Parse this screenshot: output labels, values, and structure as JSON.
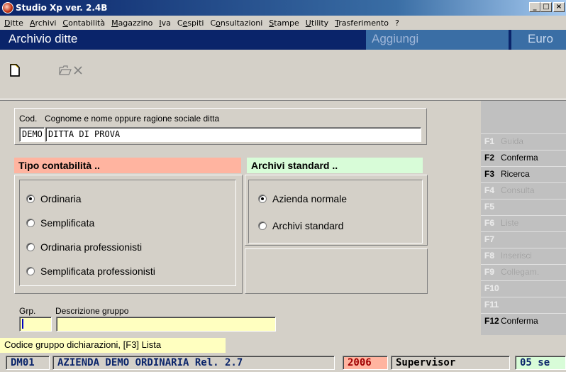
{
  "window": {
    "title": "Studio Xp ver. 2.4B",
    "minimize": "_",
    "maximize": "□",
    "close": "×"
  },
  "menu": [
    {
      "u": "D",
      "rest": "itte"
    },
    {
      "u": "A",
      "rest": "rchivi"
    },
    {
      "u": "C",
      "rest": "ontabilità"
    },
    {
      "u": "M",
      "rest": "agazzino"
    },
    {
      "u": "I",
      "rest": "va"
    },
    {
      "pre": "C",
      "u": "e",
      "rest": "spiti"
    },
    {
      "pre": "C",
      "u": "o",
      "rest": "nsultazioni"
    },
    {
      "u": "S",
      "rest": "tampe"
    },
    {
      "u": "U",
      "rest": "tility"
    },
    {
      "u": "T",
      "rest": "rasferimento"
    },
    {
      "u": "",
      "rest": "?"
    }
  ],
  "header": {
    "title": "Archivio ditte",
    "action": "Aggiungi",
    "currency": "Euro"
  },
  "toolbar": {
    "new": "new-document-icon",
    "open": "open-folder-icon",
    "delete": "delete-x-icon"
  },
  "cod": {
    "label_code": "Cod.",
    "label_name": "Cognome e nome oppure ragione sociale ditta",
    "code_value": "DEMO",
    "name_value": "DITTA DI PROVA"
  },
  "tipo": {
    "heading": "Tipo contabilità ..",
    "heading_color": "#ffb4a0",
    "options": [
      "Ordinaria",
      "Semplificata",
      "Ordinaria professionisti",
      "Semplificata professionisti"
    ],
    "selected": 0
  },
  "archivi": {
    "heading": "Archivi standard ..",
    "heading_color": "#d8fcd8",
    "options": [
      "Azienda normale",
      "Archivi standard"
    ],
    "selected": 0
  },
  "gruppo": {
    "label_code": "Grp.",
    "label_desc": "Descrizione gruppo",
    "code_value": "",
    "desc_value": ""
  },
  "fkeys": [
    {
      "key": "F1",
      "label": "Guida",
      "enabled": false
    },
    {
      "key": "F2",
      "label": "Conferma",
      "enabled": true
    },
    {
      "key": "F3",
      "label": "Ricerca",
      "enabled": true
    },
    {
      "key": "F4",
      "label": "Consulta",
      "enabled": false
    },
    {
      "key": "F5",
      "label": "",
      "enabled": false
    },
    {
      "key": "F6",
      "label": "Liste",
      "enabled": false
    },
    {
      "key": "F7",
      "label": "",
      "enabled": false
    },
    {
      "key": "F8",
      "label": "Inserisci",
      "enabled": false
    },
    {
      "key": "F9",
      "label": "Collegam.",
      "enabled": false
    },
    {
      "key": "F10",
      "label": "",
      "enabled": false
    },
    {
      "key": "F11",
      "label": "",
      "enabled": false
    },
    {
      "key": "F12",
      "label": "Conferma",
      "enabled": true
    }
  ],
  "hint": "Codice gruppo dichiarazioni, [F3] Lista",
  "status": {
    "code": "DM01",
    "company": "AZIENDA DEMO ORDINARIA Rel. 2.7",
    "year": "2006",
    "user": "Supervisor",
    "date": "05 se"
  },
  "colors": {
    "input_yellow": "#ffffc0",
    "hint_yellow": "#ffffc0",
    "year_bg": "#ffb4a0",
    "date_bg": "#d8fcd8",
    "status_text": "#0a246a"
  }
}
